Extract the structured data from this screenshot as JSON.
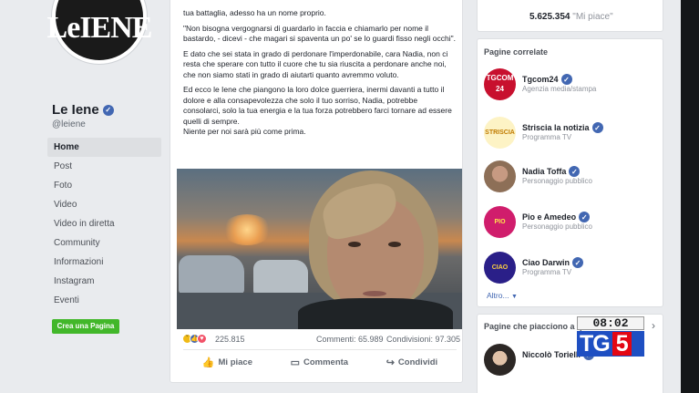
{
  "page": {
    "logo_text": "LeIENE",
    "name": "Le Iene",
    "handle": "@leiene",
    "nav": [
      {
        "label": "Home",
        "active": true
      },
      {
        "label": "Post"
      },
      {
        "label": "Foto"
      },
      {
        "label": "Video"
      },
      {
        "label": "Video in diretta"
      },
      {
        "label": "Community"
      },
      {
        "label": "Informazioni"
      },
      {
        "label": "Instagram"
      },
      {
        "label": "Eventi"
      }
    ],
    "create_page_label": "Crea una Pagina"
  },
  "post": {
    "paragraphs": [
      "tua battaglia, adesso ha un nome proprio.",
      "\"Non bisogna vergognarsi di guardarlo in faccia e chiamarlo per nome il bastardo, - dicevi - che magari si spaventa un po' se lo guardi fisso negli occhi\".",
      "E dato che sei stata in grado di perdonare l'imperdonabile, cara Nadia, non ci resta che sperare con tutto il cuore che tu sia riuscita a perdonare anche noi, che non siamo stati in grado di aiutarti quanto avremmo voluto.",
      "Ed ecco le Iene che piangono la loro dolce guerriera, inermi davanti a tutto il dolore e alla consapevolezza che solo il tuo sorriso, Nadia, potrebbe consolarci, solo la tua energia e la tua forza potrebbero farci tornare ad essere quelli di sempre.",
      "Niente per noi sarà più come prima."
    ],
    "reaction_count": "225.815",
    "comments_count": "Commenti: 65.989",
    "shares_count": "Condivisioni: 97.305",
    "actions": {
      "like": "Mi piace",
      "comment": "Commenta",
      "share": "Condividi"
    }
  },
  "sidebar": {
    "likes_count": "5.625.354",
    "likes_label": "\"Mi piace\"",
    "related_title": "Pagine correlate",
    "related": [
      {
        "avatar_text": "TGCOM 24",
        "name": "Tgcom24",
        "category": "Agenzia media/stampa"
      },
      {
        "avatar_text": "STRISCIA",
        "name": "Striscia la notizia",
        "category": "Programma TV"
      },
      {
        "avatar_text": "",
        "name": "Nadia Toffa",
        "category": "Personaggio pubblico"
      },
      {
        "avatar_text": "PIO",
        "name": "Pio e Amedeo",
        "category": "Personaggio pubblico"
      },
      {
        "avatar_text": "CIAO",
        "name": "Ciao Darwin",
        "category": "Programma TV"
      }
    ],
    "more_link": "Altro...",
    "liked_title": "Pagine che piacciono a que",
    "liked_items": [
      {
        "name": "Niccolò Torielli"
      }
    ]
  },
  "overlay": {
    "time": "08:02",
    "channel_prefix": "TG",
    "channel_number": "5"
  },
  "colors": {
    "facebook_blue": "#4267b2",
    "create_page_green": "#42b72a",
    "tg5_blue": "#1e4fc2",
    "tg5_red": "#e30613"
  }
}
